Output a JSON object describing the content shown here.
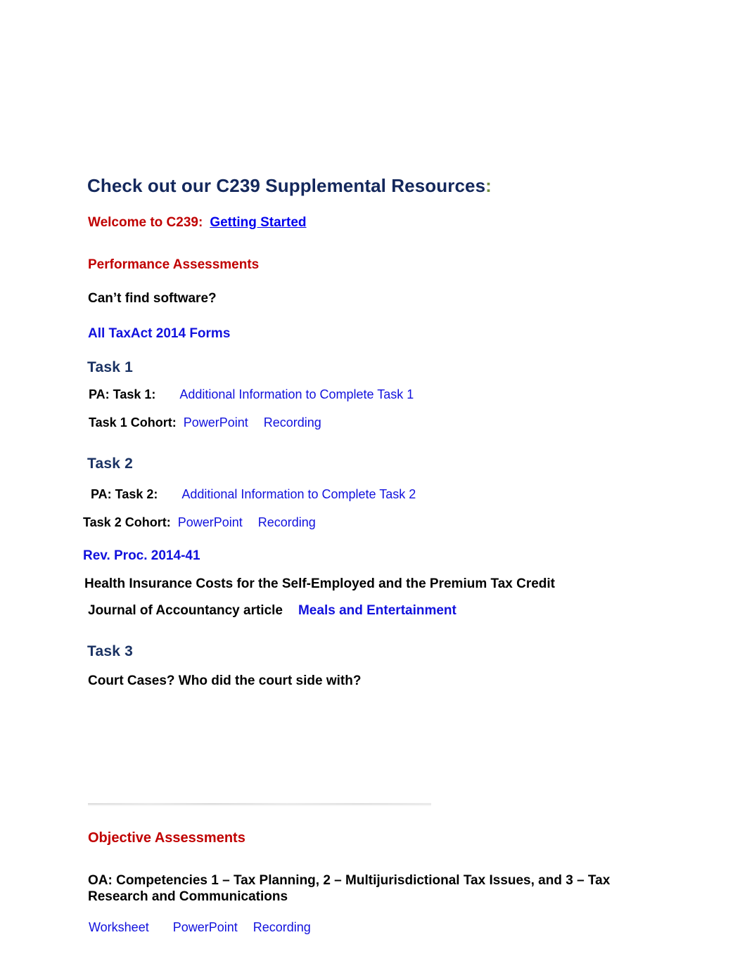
{
  "document": {
    "title_main": "Check out our C239 Supplemental Resources",
    "title_colon": ":"
  },
  "welcome": {
    "label": "Welcome to C239:",
    "link": "Getting Started"
  },
  "performance": {
    "heading": "Performance Assessments",
    "software_question": "Can’t find software?",
    "taxact_link": "All TaxAct 2014 Forms"
  },
  "task1": {
    "heading": "Task 1",
    "pa_label": "PA:  Task 1:",
    "pa_link": "Additional Information to Complete Task 1",
    "cohort_label": "Task 1 Cohort:",
    "cohort_link_powerpoint": "PowerPoint",
    "cohort_link_recording": "Recording"
  },
  "task2": {
    "heading": "Task 2",
    "pa_label": "PA:  Task 2:",
    "pa_link": "Additional Information to Complete Task 2",
    "cohort_label": "Task 2 Cohort:",
    "cohort_link_powerpoint": "PowerPoint",
    "cohort_link_recording": "Recording",
    "rev_proc_link": "Rev. Proc. 2014-41",
    "health_insurance_text": "Health Insurance Costs for the Self-Employed and the Premium Tax Credit",
    "journal_text": "Journal of Accountancy article",
    "meals_link": "Meals and Entertainment"
  },
  "task3": {
    "heading": "Task 3",
    "court_cases_text": "Court Cases?  Who did the court side with?"
  },
  "objective": {
    "heading": "Objective Assessments",
    "oa_text": "OA:  Competencies 1 – Tax Planning,  2 – Multijurisdictional Tax Issues, and 3 – Tax Research and Communications",
    "link_worksheet": "Worksheet",
    "link_powerpoint": "PowerPoint",
    "link_recording": "Recording"
  },
  "colors": {
    "navy": "#14285C",
    "crimson": "#C00000",
    "link_blue": "#1111DD",
    "olive": "#6E8B3D",
    "black": "#000000"
  }
}
